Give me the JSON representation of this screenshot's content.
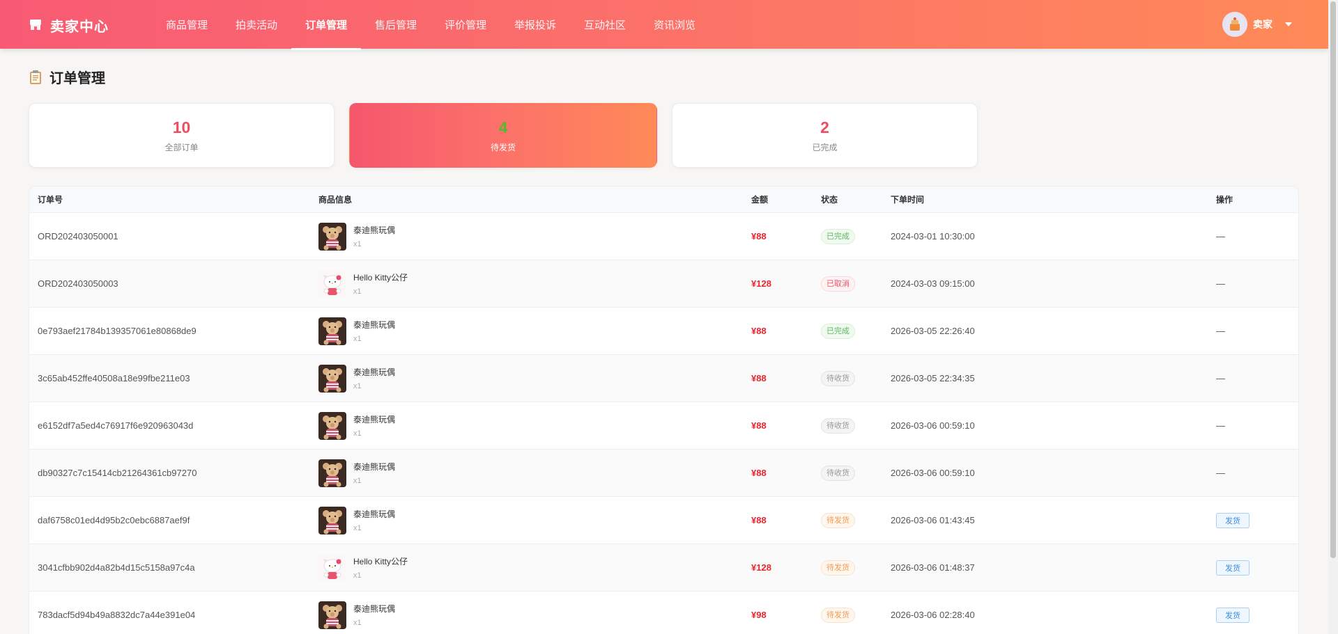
{
  "header": {
    "brand": "卖家中心",
    "nav": [
      {
        "label": "商品管理"
      },
      {
        "label": "拍卖活动"
      },
      {
        "label": "订单管理",
        "active": true
      },
      {
        "label": "售后管理"
      },
      {
        "label": "评价管理"
      },
      {
        "label": "举报投诉"
      },
      {
        "label": "互动社区"
      },
      {
        "label": "资讯浏览"
      }
    ],
    "user": "卖家"
  },
  "page": {
    "title": "订单管理"
  },
  "stats": [
    {
      "num": "10",
      "label": "全部订单"
    },
    {
      "num": "4",
      "label": "待发货",
      "active": true
    },
    {
      "num": "2",
      "label": "已完成"
    }
  ],
  "table": {
    "headers": {
      "id": "订单号",
      "product": "商品信息",
      "amount": "金额",
      "status": "状态",
      "time": "下单时间",
      "op": "操作"
    },
    "rows": [
      {
        "id": "ORD202403050001",
        "product": "泰迪熊玩偶",
        "qty": "x1",
        "thumb": "bear",
        "amount": "¥88",
        "status": "已完成",
        "status_type": "done",
        "time": "2024-03-01 10:30:00",
        "op": "—"
      },
      {
        "id": "ORD202403050003",
        "product": "Hello Kitty公仔",
        "qty": "x1",
        "thumb": "kitty",
        "amount": "¥128",
        "status": "已取消",
        "status_type": "cancel",
        "time": "2024-03-03 09:15:00",
        "op": "—"
      },
      {
        "id": "0e793aef21784b139357061e80868de9",
        "product": "泰迪熊玩偶",
        "qty": "x1",
        "thumb": "bear",
        "amount": "¥88",
        "status": "已完成",
        "status_type": "done",
        "time": "2026-03-05 22:26:40",
        "op": "—"
      },
      {
        "id": "3c65ab452ffe40508a18e99fbe211e03",
        "product": "泰迪熊玩偶",
        "qty": "x1",
        "thumb": "bear",
        "amount": "¥88",
        "status": "待收货",
        "status_type": "recv",
        "time": "2026-03-05 22:34:35",
        "op": "—"
      },
      {
        "id": "e6152df7a5ed4c76917f6e920963043d",
        "product": "泰迪熊玩偶",
        "qty": "x1",
        "thumb": "bear",
        "amount": "¥88",
        "status": "待收货",
        "status_type": "recv",
        "time": "2026-03-06 00:59:10",
        "op": "—"
      },
      {
        "id": "db90327c7c15414cb21264361cb97270",
        "product": "泰迪熊玩偶",
        "qty": "x1",
        "thumb": "bear",
        "amount": "¥88",
        "status": "待收货",
        "status_type": "recv",
        "time": "2026-03-06 00:59:10",
        "op": "—"
      },
      {
        "id": "daf6758c01ed4d95b2c0ebc6887aef9f",
        "product": "泰迪熊玩偶",
        "qty": "x1",
        "thumb": "bear",
        "amount": "¥88",
        "status": "待发货",
        "status_type": "ship",
        "time": "2026-03-06 01:43:45",
        "op": "发货"
      },
      {
        "id": "3041cfbb902d4a82b4d15c5158a97c4a",
        "product": "Hello Kitty公仔",
        "qty": "x1",
        "thumb": "kitty",
        "amount": "¥128",
        "status": "待发货",
        "status_type": "ship",
        "time": "2026-03-06 01:48:37",
        "op": "发货"
      },
      {
        "id": "783dacf5d94b49a8832dc7a44e391e04",
        "product": "泰迪熊玩偶",
        "qty": "x1",
        "thumb": "bear",
        "amount": "¥98",
        "status": "待发货",
        "status_type": "ship",
        "time": "2026-03-06 02:28:40",
        "op": "发货"
      }
    ]
  },
  "colors": {
    "header_gradient_start": "#f85a74",
    "header_gradient_end": "#ff8a58",
    "price": "#e8262e",
    "accent_number": "#ee4d5f",
    "active_number": "#57b82d"
  },
  "icons": {
    "brand": "shop-icon",
    "title": "clipboard-icon",
    "user_menu": "chevron-down-icon"
  }
}
